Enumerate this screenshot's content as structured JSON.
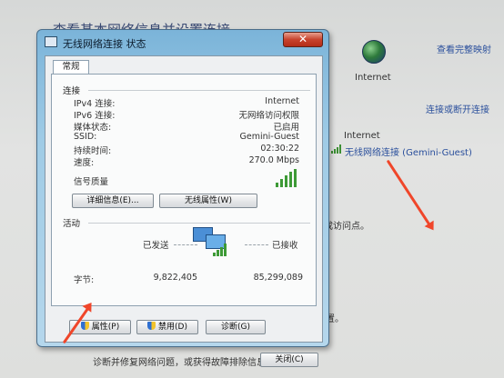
{
  "background": {
    "title": "查看基本网络信息并设置连接",
    "view_full_map": "查看完整映射",
    "internet_top": "Internet",
    "connect_disconnect": "连接或断开连接",
    "internet_side": "Internet",
    "network_link": "无线网络连接 (Gemini-Guest)",
    "access_point_text": "成访问点。",
    "setup_text": "置。",
    "diagnose_text": "诊断并修复网络问题，或获得故障排除信息。"
  },
  "dialog": {
    "title": "无线网络连接 状态",
    "close_glyph": "✕",
    "tab": "常规",
    "connection_section": "连接",
    "rows": [
      {
        "label": "IPv4 连接:",
        "value": "Internet"
      },
      {
        "label": "IPv6 连接:",
        "value": "无网络访问权限"
      },
      {
        "label": "媒体状态:",
        "value": "已启用"
      },
      {
        "label": "SSID:",
        "value": "Gemini-Guest"
      },
      {
        "label": "持续时间:",
        "value": "02:30:22"
      },
      {
        "label": "速度:",
        "value": "270.0 Mbps"
      }
    ],
    "signal_label": "信号质量",
    "details_button": "详细信息(E)...",
    "wireless_props_button": "无线属性(W)",
    "activity_section": "活动",
    "sent_label": "已发送",
    "received_label": "已接收",
    "bytes_label": "字节:",
    "bytes_sent": "9,822,405",
    "bytes_received": "85,299,089",
    "properties_button": "属性(P)",
    "disable_button": "禁用(D)",
    "diagnose_button": "诊断(G)",
    "close_button": "关闭(C)"
  },
  "colors": {
    "accent_link": "#2a4f9c",
    "signal_green": "#3d9a36",
    "annotation_arrow": "#f0462a"
  }
}
